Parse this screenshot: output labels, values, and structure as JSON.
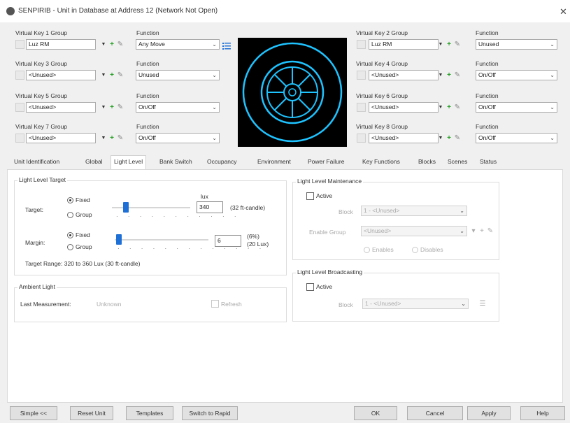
{
  "window": {
    "title": "SENPIRIB - Unit in Database at Address 12 (Network Not Open)"
  },
  "virtual_keys": [
    {
      "group_label": "Virtual Key 1 Group",
      "group_value": "Luz RM",
      "function_label": "Function",
      "function_value": "Any Move"
    },
    {
      "group_label": "Virtual Key 2 Group",
      "group_value": "Luz RM",
      "function_label": "Function",
      "function_value": "Unused"
    },
    {
      "group_label": "Virtual Key 3 Group",
      "group_value": "<Unused>",
      "function_label": "Function",
      "function_value": "Unused"
    },
    {
      "group_label": "Virtual Key 4 Group",
      "group_value": "<Unused>",
      "function_label": "Function",
      "function_value": "On/Off"
    },
    {
      "group_label": "Virtual Key 5 Group",
      "group_value": "<Unused>",
      "function_label": "Function",
      "function_value": "On/Off"
    },
    {
      "group_label": "Virtual Key 6 Group",
      "group_value": "<Unused>",
      "function_label": "Function",
      "function_value": "On/Off"
    },
    {
      "group_label": "Virtual Key 7 Group",
      "group_value": "<Unused>",
      "function_label": "Function",
      "function_value": "On/Off"
    },
    {
      "group_label": "Virtual Key 8 Group",
      "group_value": "<Unused>",
      "function_label": "Function",
      "function_value": "On/Off"
    }
  ],
  "tabs": [
    "Unit Identification",
    "Global",
    "Light Level",
    "Bank Switch",
    "Occupancy",
    "Environment",
    "Power Failure",
    "Key Functions",
    "Blocks",
    "Scenes",
    "Status"
  ],
  "active_tab": "Light Level",
  "light_level_target": {
    "title": "Light Level Target",
    "target_label": "Target:",
    "target_fixed": "Fixed",
    "target_group": "Group",
    "lux_label": "lux",
    "target_value": "340",
    "target_fc": "(32 ft-candle)",
    "target_slider_fraction": 0.1,
    "margin_label": "Margin:",
    "margin_fixed": "Fixed",
    "margin_group": "Group",
    "margin_value": "6",
    "margin_pct": "(6%)",
    "margin_lux": "(20 Lux)",
    "margin_slider_fraction": 0.0,
    "range_text": "Target Range:  320 to 360 Lux (30 ft-candle)"
  },
  "ambient_light": {
    "title": "Ambient Light",
    "last_label": "Last Measurement:",
    "last_value": "Unknown",
    "refresh_label": "Refresh"
  },
  "maintenance": {
    "title": "Light Level Maintenance",
    "active_label": "Active",
    "block_label": "Block",
    "block_value": "1 - <Unused>",
    "enable_group_label": "Enable Group",
    "enable_group_value": "<Unused>",
    "enables_label": "Enables",
    "disables_label": "Disables"
  },
  "broadcasting": {
    "title": "Light Level Broadcasting",
    "active_label": "Active",
    "block_label": "Block",
    "block_value": "1 - <Unused>"
  },
  "buttons": {
    "simple": "Simple <<",
    "reset": "Reset Unit",
    "templates": "Templates",
    "switch_rapid": "Switch to Rapid",
    "ok": "OK",
    "cancel": "Cancel",
    "apply": "Apply",
    "help": "Help"
  },
  "colors": {
    "accent": "#1e6fd6",
    "wheel": "#1ec3ff",
    "plus": "#2aa02a"
  }
}
